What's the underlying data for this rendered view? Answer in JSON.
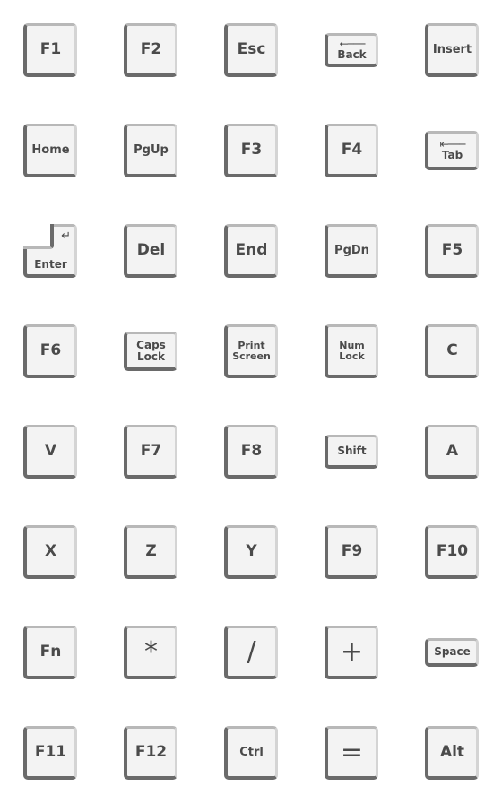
{
  "colors": {
    "key_face": "#f3f3f3",
    "key_shadow": "#6a6a6a",
    "key_highlight": "#d4d4d4",
    "label": "#4a4a4a"
  },
  "keys": [
    {
      "label": "F1",
      "shape": "standard"
    },
    {
      "label": "F2",
      "shape": "standard"
    },
    {
      "label": "Esc",
      "shape": "standard"
    },
    {
      "label": "Back",
      "shape": "short",
      "icon": "left-arrow-icon"
    },
    {
      "label": "Insert",
      "shape": "standard"
    },
    {
      "label": "Home",
      "shape": "standard"
    },
    {
      "label": "PgUp",
      "shape": "standard"
    },
    {
      "label": "F3",
      "shape": "standard"
    },
    {
      "label": "F4",
      "shape": "standard"
    },
    {
      "label": "Tab",
      "shape": "short",
      "icon": "tab-arrow-icon"
    },
    {
      "label": "Enter",
      "shape": "enter",
      "icon": "return-arrow-icon"
    },
    {
      "label": "Del",
      "shape": "standard"
    },
    {
      "label": "End",
      "shape": "standard"
    },
    {
      "label": "PgDn",
      "shape": "standard"
    },
    {
      "label": "F5",
      "shape": "standard"
    },
    {
      "label": "F6",
      "shape": "standard"
    },
    {
      "label": "Caps Lock",
      "shape": "short"
    },
    {
      "label": "Print Screen",
      "shape": "standard"
    },
    {
      "label": "Num Lock",
      "shape": "standard"
    },
    {
      "label": "C",
      "shape": "standard"
    },
    {
      "label": "V",
      "shape": "standard"
    },
    {
      "label": "F7",
      "shape": "standard"
    },
    {
      "label": "F8",
      "shape": "standard"
    },
    {
      "label": "Shift",
      "shape": "short"
    },
    {
      "label": "A",
      "shape": "standard"
    },
    {
      "label": "X",
      "shape": "standard"
    },
    {
      "label": "Z",
      "shape": "standard"
    },
    {
      "label": "Y",
      "shape": "standard"
    },
    {
      "label": "F9",
      "shape": "standard"
    },
    {
      "label": "F10",
      "shape": "standard"
    },
    {
      "label": "Fn",
      "shape": "standard"
    },
    {
      "label": "*",
      "shape": "standard"
    },
    {
      "label": "/",
      "shape": "standard"
    },
    {
      "label": "+",
      "shape": "standard"
    },
    {
      "label": "Space",
      "shape": "short"
    },
    {
      "label": "F11",
      "shape": "standard"
    },
    {
      "label": "F12",
      "shape": "standard"
    },
    {
      "label": "Ctrl",
      "shape": "standard"
    },
    {
      "label": "=",
      "shape": "standard"
    },
    {
      "label": "Alt",
      "shape": "standard"
    }
  ]
}
